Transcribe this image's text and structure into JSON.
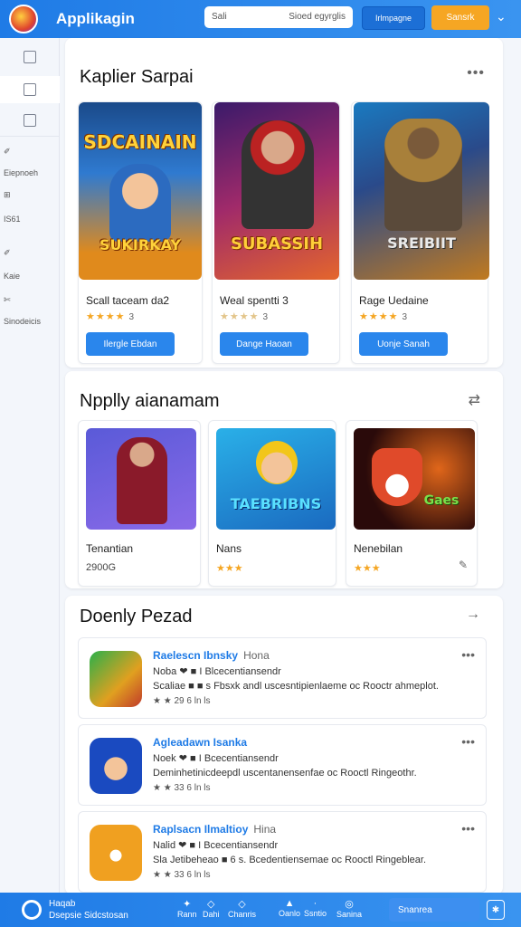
{
  "header": {
    "title": "Applikagin",
    "search_placeholder": "Sali",
    "search_hint": "Sioed egyrglis",
    "btn_primary": "Irlmpagne",
    "btn_secondary": "Sansrk",
    "chevron": "⌄"
  },
  "sidebar": {
    "items": [
      {
        "icon": "home-icon"
      },
      {
        "icon": "page-icon"
      },
      {
        "icon": "library-icon"
      }
    ],
    "labels": [
      "Eiepnoeh",
      "IS61",
      "Kaie",
      "Sinodeicis"
    ]
  },
  "section1": {
    "title": "Kaplier Sarpai",
    "more": "•••",
    "cards": [
      {
        "cover_text": "SDCAINAIN",
        "cover_sub": "SUKIRKAY",
        "title": "Scall taceam da2",
        "stars": "★★★★",
        "rating": "3",
        "button": "Ilergle Ebdan"
      },
      {
        "cover_text": "SUBASSIH",
        "cover_sub": "",
        "title": "Weal spentti 3",
        "stars": "★★★★",
        "rating": "3",
        "button": "Dange Haoan"
      },
      {
        "cover_text": "SREIBIIT",
        "cover_sub": "",
        "title": "Rage Uedaine",
        "stars": "★★★★",
        "rating": "3",
        "button": "Uonje Sanah"
      }
    ]
  },
  "section2": {
    "title": "Npplly aianamam",
    "more": "⇄",
    "cards": [
      {
        "title": "Tenantian",
        "meta": "2900G"
      },
      {
        "title": "Nans",
        "meta": "★★★"
      },
      {
        "title": "Nenebilan",
        "meta": "★★★"
      }
    ]
  },
  "section3": {
    "title": "Doenly Pezad",
    "arrow": "→",
    "rows": [
      {
        "title": "Raelescn Ibnsky",
        "sub": "Hona",
        "line1": "Noba ❤ ■ I Blcecentiansendr",
        "line2": "Scaliae ■ ■ s Fbsxk andl uscesntipienlaeme oc Rooctr ahmeplot.",
        "meta": "★ ★ 29   6 ln ls",
        "more": "•••"
      },
      {
        "title": "Agleadawn Isanka",
        "sub": "",
        "line1": "Noek ❤ ■ I Bcecentiansendr",
        "line2": "Deminhetinicdeepdl uscentanensenfae oc Rooctl Ringeothr.",
        "meta": "★ ★ 33   6 ln ls",
        "more": "•••"
      },
      {
        "title": "Raplsacn Ilmaltioy",
        "sub": "Hina",
        "line1": "Nalid ❤ ■ I Bcecentiansendr",
        "line2": "Sla Jetibeheao ■ 6 s. Bcedentiensemae oc Rooctl Ringeblear.",
        "meta": "★ ★ 33   6 ln ls",
        "more": "•••"
      }
    ]
  },
  "bottom": {
    "line1": "Haqab",
    "line2": "Dsepsie Sidcstosan",
    "nav": [
      {
        "icon": "✦",
        "label": "Rann",
        "sub": "Haris"
      },
      {
        "icon": "◇",
        "label": "Dahi",
        "sub": "Chanris"
      },
      {
        "icon": "▲",
        "label": "Ssntio",
        "sub": "Oanlo"
      },
      {
        "icon": "◎",
        "label": "",
        "sub": "Sanina"
      }
    ],
    "pill": "Snanrea",
    "sq": "✱"
  }
}
